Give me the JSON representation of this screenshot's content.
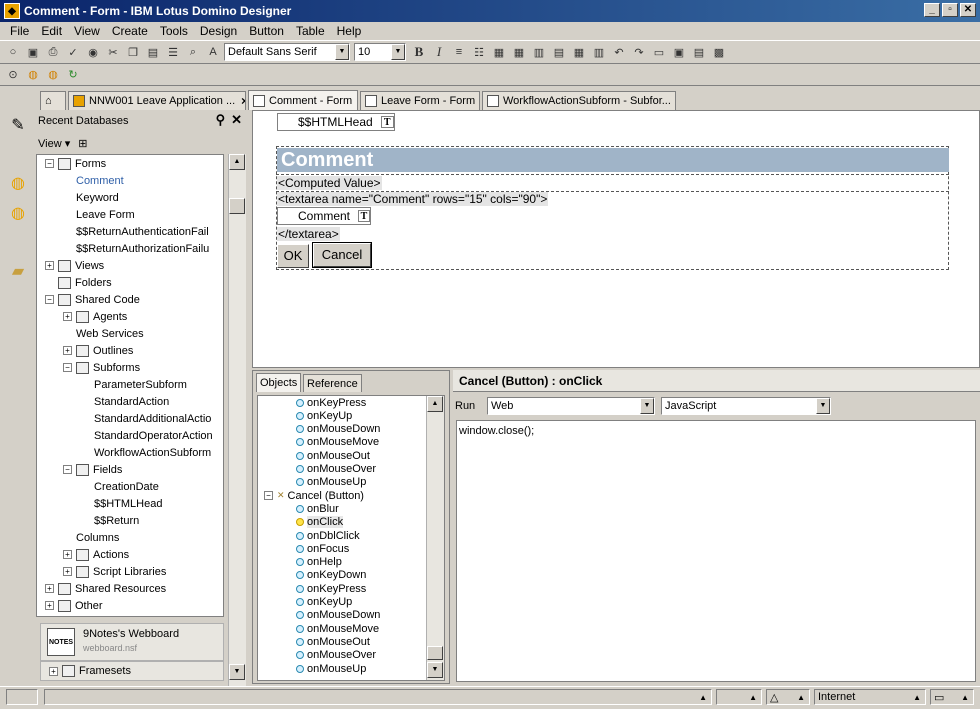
{
  "window": {
    "title": "Comment - Form - IBM Lotus Domino Designer",
    "min": "_",
    "restore": "▫",
    "close": "✕"
  },
  "menu": [
    "File",
    "Edit",
    "View",
    "Create",
    "Tools",
    "Design",
    "Button",
    "Table",
    "Help"
  ],
  "toolbar": {
    "font_name": "Default Sans Serif",
    "font_size": "10",
    "bold": "B",
    "italic": "I"
  },
  "tabs": [
    {
      "label": "NNW001 Leave Application ..."
    },
    {
      "label": "Comment - Form"
    },
    {
      "label": "Leave Form - Form"
    },
    {
      "label": "WorkflowActionSubform - Subfor..."
    }
  ],
  "nav": {
    "header": "Recent Databases",
    "view_label": "View ▾",
    "tree": [
      {
        "label": "Forms",
        "depth": 0,
        "exp": "−"
      },
      {
        "label": "Comment",
        "depth": 1,
        "selected": true
      },
      {
        "label": "Keyword",
        "depth": 1
      },
      {
        "label": "Leave Form",
        "depth": 1
      },
      {
        "label": "$$ReturnAuthenticationFail",
        "depth": 1
      },
      {
        "label": "$$ReturnAuthorizationFailu",
        "depth": 1
      },
      {
        "label": "Views",
        "depth": 0,
        "exp": "+"
      },
      {
        "label": "Folders",
        "depth": 0
      },
      {
        "label": "Shared Code",
        "depth": 0,
        "exp": "−"
      },
      {
        "label": "Agents",
        "depth": 1,
        "exp": "+"
      },
      {
        "label": "Web Services",
        "depth": 1
      },
      {
        "label": "Outlines",
        "depth": 1,
        "exp": "+"
      },
      {
        "label": "Subforms",
        "depth": 1,
        "exp": "−"
      },
      {
        "label": "ParameterSubform",
        "depth": 2
      },
      {
        "label": "StandardAction",
        "depth": 2
      },
      {
        "label": "StandardAdditionalActio",
        "depth": 2
      },
      {
        "label": "StandardOperatorAction",
        "depth": 2
      },
      {
        "label": "WorkflowActionSubform",
        "depth": 2
      },
      {
        "label": "Fields",
        "depth": 1,
        "exp": "−"
      },
      {
        "label": "CreationDate",
        "depth": 2
      },
      {
        "label": "$$HTMLHead",
        "depth": 2
      },
      {
        "label": "$$Return",
        "depth": 2
      },
      {
        "label": "Columns",
        "depth": 1
      },
      {
        "label": "Actions",
        "depth": 1,
        "exp": "+"
      },
      {
        "label": "Script Libraries",
        "depth": 1,
        "exp": "+"
      },
      {
        "label": "Shared Resources",
        "depth": 0,
        "exp": "+"
      },
      {
        "label": "Other",
        "depth": 0,
        "exp": "+"
      }
    ],
    "webboard_title": "9Notes's Webboard",
    "webboard_file": "webboard.nsf",
    "webboard_icon": "NOTES",
    "framesets": "Framesets"
  },
  "design": {
    "htmlhead": "$$HTMLHead",
    "comment_title": "Comment",
    "computed": "<Computed Value>",
    "textarea_open": "<textarea name=\"Comment\" rows=\"15\" cols=\"90\">",
    "comment_field": "Comment",
    "textarea_close": "</textarea>",
    "ok": "OK",
    "cancel": "Cancel",
    "field_marker": "T"
  },
  "objects": {
    "tab_objects": "Objects",
    "tab_reference": "Reference",
    "items": [
      {
        "label": "onKeyPress",
        "indent": 1,
        "kind": "event"
      },
      {
        "label": "onKeyUp",
        "indent": 1,
        "kind": "event"
      },
      {
        "label": "onMouseDown",
        "indent": 1,
        "kind": "event"
      },
      {
        "label": "onMouseMove",
        "indent": 1,
        "kind": "event"
      },
      {
        "label": "onMouseOut",
        "indent": 1,
        "kind": "event"
      },
      {
        "label": "onMouseOver",
        "indent": 1,
        "kind": "event"
      },
      {
        "label": "onMouseUp",
        "indent": 1,
        "kind": "event"
      },
      {
        "label": "Cancel (Button)",
        "indent": 0,
        "kind": "button"
      },
      {
        "label": "onBlur",
        "indent": 1,
        "kind": "event"
      },
      {
        "label": "onClick",
        "indent": 1,
        "kind": "event",
        "selected": true
      },
      {
        "label": "onDblClick",
        "indent": 1,
        "kind": "event"
      },
      {
        "label": "onFocus",
        "indent": 1,
        "kind": "event"
      },
      {
        "label": "onHelp",
        "indent": 1,
        "kind": "event"
      },
      {
        "label": "onKeyDown",
        "indent": 1,
        "kind": "event"
      },
      {
        "label": "onKeyPress",
        "indent": 1,
        "kind": "event"
      },
      {
        "label": "onKeyUp",
        "indent": 1,
        "kind": "event"
      },
      {
        "label": "onMouseDown",
        "indent": 1,
        "kind": "event"
      },
      {
        "label": "onMouseMove",
        "indent": 1,
        "kind": "event"
      },
      {
        "label": "onMouseOut",
        "indent": 1,
        "kind": "event"
      },
      {
        "label": "onMouseOver",
        "indent": 1,
        "kind": "event"
      },
      {
        "label": "onMouseUp",
        "indent": 1,
        "kind": "event"
      }
    ]
  },
  "code": {
    "header": "Cancel (Button) : onClick",
    "run_label": "Run",
    "run_target": "Web",
    "language": "JavaScript",
    "text": "window.close();"
  },
  "status": {
    "zone": "Internet"
  }
}
